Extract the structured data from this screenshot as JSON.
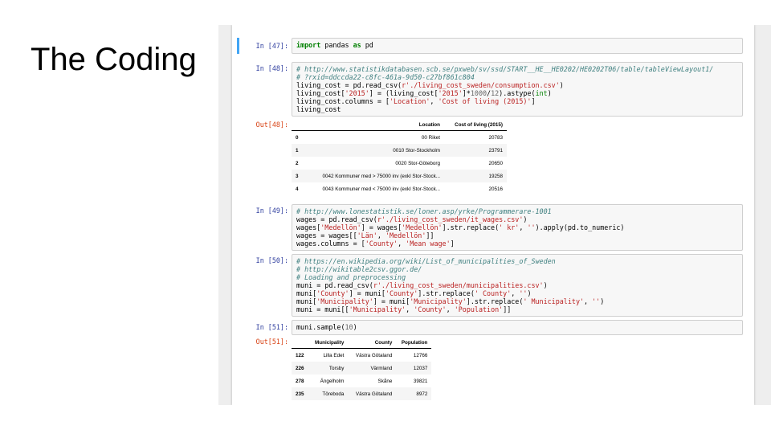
{
  "slide": {
    "title": "The Coding"
  },
  "cells": {
    "c47": {
      "prompt": "In [47]:",
      "t1": "import",
      "t2": " pandas ",
      "t3": "as",
      "t4": " pd"
    },
    "c48": {
      "prompt": "In [48]:",
      "l1": "# http://www.statistikdatabasen.scb.se/pxweb/sv/ssd/START__HE__HE0202/HE0202T06/table/tableViewLayout1/",
      "l2": "# ?rxid=ddccda22-c8fc-461a-9d50-c27bf861c804",
      "l3a": "living_cost = pd.read_csv(",
      "l3b": "r'./living_cost_sweden/consumption.csv'",
      "l3c": ")",
      "l4a": "living_cost[",
      "l4b": "'2015'",
      "l4c": "] = (living_cost[",
      "l4d": "'2015'",
      "l4e": "]*",
      "l4f": "1000",
      "l4g": "/",
      "l4h": "12",
      "l4i": ").astype(",
      "l4j": "int",
      "l4k": ")",
      "l5a": "living_cost.columns = [",
      "l5b": "'Location'",
      "l5c": ", ",
      "l5d": "'Cost of living (2015)'",
      "l5e": "]",
      "l6": "living_cost",
      "out_prompt": "Out[48]:",
      "table": {
        "headers": [
          "",
          "Location",
          "Cost of living (2015)"
        ],
        "rows": [
          [
            "0",
            "00 Riket",
            "20783"
          ],
          [
            "1",
            "0010 Stor-Stockholm",
            "23791"
          ],
          [
            "2",
            "0020 Stor-Göteborg",
            "20650"
          ],
          [
            "3",
            "0042 Kommuner med > 75000 inv (exkl Stor-Stock...",
            "19258"
          ],
          [
            "4",
            "0043 Kommuner med < 75000 inv (exkl Stor-Stock...",
            "20516"
          ]
        ]
      }
    },
    "c49": {
      "prompt": "In [49]:",
      "l1": "# http://www.lonestatistik.se/loner.asp/yrke/Programmerare-1001",
      "l2a": "wages = pd.read_csv(",
      "l2b": "r'./living_cost_sweden/it_wages.csv'",
      "l2c": ")",
      "l3a": "wages[",
      "l3b": "'Medellön'",
      "l3c": "] = wages[",
      "l3d": "'Medellön'",
      "l3e": "].str.replace(",
      "l3f": "' kr'",
      "l3g": ", ",
      "l3h": "''",
      "l3i": ").apply(pd.to_numeric)",
      "l4a": "wages = wages[[",
      "l4b": "'Län'",
      "l4c": ", ",
      "l4d": "'Medellön'",
      "l4e": "]]",
      "l5a": "wages.columns = [",
      "l5b": "'County'",
      "l5c": ", ",
      "l5d": "'Mean wage'",
      "l5e": "]"
    },
    "c50": {
      "prompt": "In [50]:",
      "l1": "# https://en.wikipedia.org/wiki/List_of_municipalities_of_Sweden",
      "l2": "# http://wikitable2csv.ggor.de/",
      "l3": "# Loading and preprocessing",
      "l4a": "muni = pd.read_csv(",
      "l4b": "r'./living_cost_sweden/municipalities.csv'",
      "l4c": ")",
      "l5a": "muni[",
      "l5b": "'County'",
      "l5c": "] = muni[",
      "l5d": "'County'",
      "l5e": "].str.replace(",
      "l5f": "' County'",
      "l5g": ", ",
      "l5h": "''",
      "l5i": ")",
      "l6a": "muni[",
      "l6b": "'Municipality'",
      "l6c": "] = muni[",
      "l6d": "'Municipality'",
      "l6e": "].str.replace(",
      "l6f": "' Municipality'",
      "l6g": ", ",
      "l6h": "''",
      "l6i": ")",
      "l7a": "muni = muni[[",
      "l7b": "'Municipality'",
      "l7c": ", ",
      "l7d": "'County'",
      "l7e": ", ",
      "l7f": "'Population'",
      "l7g": "]]"
    },
    "c51": {
      "prompt": "In [51]:",
      "l1a": "muni.sample(",
      "l1b": "10",
      "l1c": ")",
      "out_prompt": "Out[51]:",
      "table": {
        "headers": [
          "",
          "Municipality",
          "County",
          "Population"
        ],
        "rows": [
          [
            "122",
            "Lilla Edet",
            "Västra Götaland",
            "12766"
          ],
          [
            "226",
            "Torsby",
            "Värmland",
            "12037"
          ],
          [
            "278",
            "Ängelholm",
            "Skåne",
            "39821"
          ],
          [
            "235",
            "Töreboda",
            "Västra Götaland",
            "8972"
          ]
        ]
      }
    }
  }
}
